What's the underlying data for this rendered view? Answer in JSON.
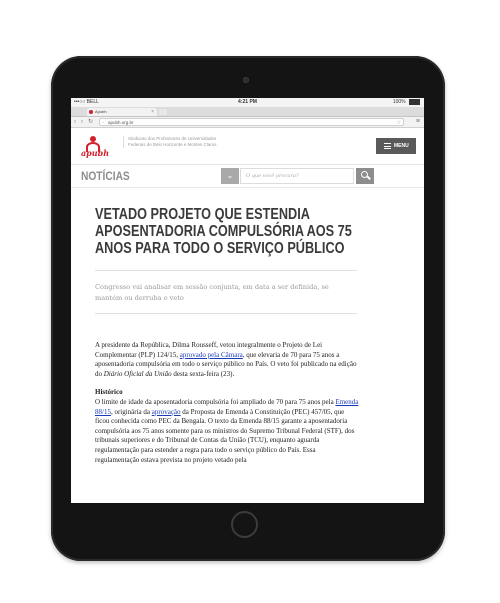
{
  "statusbar": {
    "carrier": "•••○○ BELL",
    "time": "4:21 PM",
    "battery": "100%"
  },
  "browser": {
    "tab_title": "Apubh",
    "url": "apubh.org.br",
    "back": "‹",
    "forward": "›",
    "reload": "↻"
  },
  "site": {
    "logo_text": "apubh",
    "sindicato": "Sindicato dos Professores de Universidades Federais de Belo Horizonte e Montes Claros",
    "menu_label": "MENU"
  },
  "newsbar": {
    "title": "NOTÍCIAS",
    "search_placeholder": "O que você procura?"
  },
  "article": {
    "headline": "VETADO PROJETO QUE ESTENDIA APOSENTADORIA COMPULSÓRIA AOS 75 ANOS PARA TODO O SERVIÇO PÚBLICO",
    "subtitle": "Congresso vai analisar em sessão conjunta, em data a ser definida, se mantém ou derruba o veto",
    "p1_a": "A presidente da República, Dilma Rousseff, vetou integralmente o Projeto de Lei Complementar (PLP) 124/15, ",
    "p1_link": "aprovado pela Câmara",
    "p1_b": ", que elevaria de 70 para 75 anos a aposentadoria compulsória em todo o serviço público no País. O veto foi publicado na edição do ",
    "p1_em": "Diário Oficial da União",
    "p1_c": " desta sexta-feira (23).",
    "historico_title": "Histórico",
    "p2_a": "O limite de idade da aposentadoria compulsória foi ampliado de 70 para 75 anos pela ",
    "p2_link1": "Emenda 88/15",
    "p2_b": ", originária da ",
    "p2_link2": "aprovação",
    "p2_c": " da Proposta de Emenda à Constituição (PEC) 457/05, que ficou conhecida como PEC da Bengala. O texto da Emenda 88/15 garante a aposentadoria compulsória aos 75 anos somente para os ministros do Supremo Tribunal Federal (STF), dos tribunais superiores e do Tribunal de Contas da União (TCU), enquanto aguarda regulamentação para estender a regra para todo o serviço público do País. Essa regulamentação estava prevista no projeto vetado pela"
  }
}
